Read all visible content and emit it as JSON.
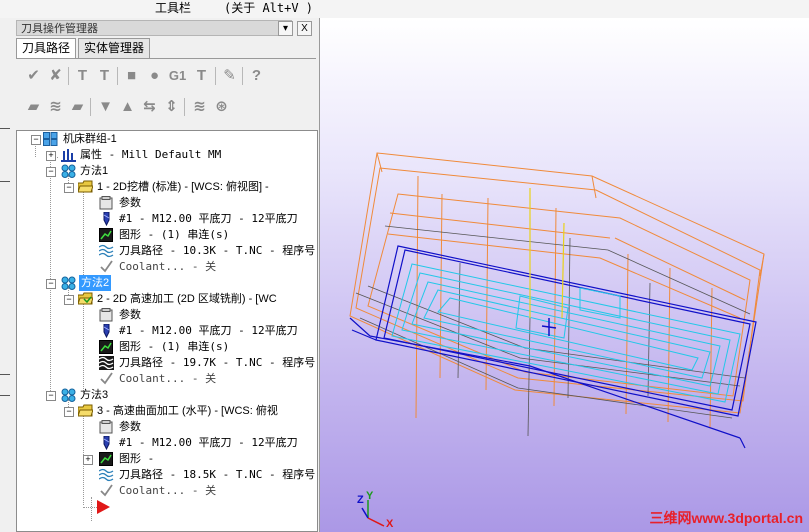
{
  "topbar": {
    "label1": "工具栏",
    "label2": "(关于 Alt+V )"
  },
  "panel": {
    "title": "刀具操作管理器",
    "dropdown_glyph": "▾",
    "close_glyph": "X",
    "tabs": [
      {
        "label": "刀具路径",
        "active": true
      },
      {
        "label": "实体管理器",
        "active": false
      }
    ]
  },
  "toolbar_row1": [
    "select-all-ops-icon",
    "select-invalid-ops-icon",
    "regenerate-selected-icon",
    "regenerate-dirty-icon",
    "verify-icon",
    "backplot-icon",
    "gcode-icon",
    "post-icon",
    "highspeed-icon",
    "help-icon"
  ],
  "toolbar_row2": [
    "lock-icon",
    "toggle-display-icon",
    "post-toggle-icon",
    "move-down-icon",
    "move-up-icon",
    "insert-arrow-icon",
    "scroll-icon",
    "wave-icon",
    "magnify-icon"
  ],
  "tree": {
    "root": "机床群组-1",
    "properties": "属性 - Mill Default MM",
    "groups": [
      {
        "name": "方法1",
        "selected": false,
        "op": "1 - 2D挖槽 (标准) - [WCS: 俯视图] -",
        "params": "参数",
        "tool": "#1 - M12.00 平底刀 - 12平底刀",
        "geometry": "图形 - (1) 串连(s)",
        "path": "刀具路径 - 10.3K - T.NC - 程序号",
        "coolant": "Coolant... - 关"
      },
      {
        "name": "方法2",
        "selected": true,
        "op": "2 - 2D 高速加工 (2D 区域铣削) - [WC",
        "params": "参数",
        "tool": "#1 - M12.00 平底刀 - 12平底刀",
        "geometry": "图形 - (1) 串连(s)",
        "path": "刀具路径 - 19.7K - T.NC - 程序号",
        "coolant": "Coolant... - 关"
      },
      {
        "name": "方法3",
        "selected": false,
        "op": "3 - 高速曲面加工 (水平) - [WCS: 俯视",
        "params": "参数",
        "tool": "#1 - M12.00 平底刀 - 12平底刀",
        "geometry": "图形 -",
        "path": "刀具路径 - 18.5K - T.NC - 程序号",
        "coolant": "Coolant... - 关"
      }
    ]
  },
  "viewport": {
    "axis_labels": {
      "x": "X",
      "y": "Y",
      "z": "Z"
    },
    "watermark": "三维网www.3dportal.cn",
    "colors": {
      "stock": "#f08a3a",
      "part": "#1010c8",
      "toolpath": "#22c8e8",
      "wire": "#444444",
      "tool": "#e8d21a"
    }
  }
}
